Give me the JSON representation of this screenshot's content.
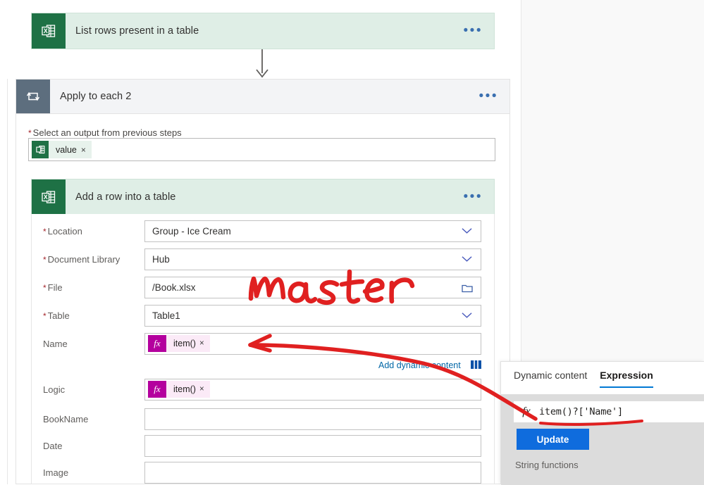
{
  "flow": {
    "steps": [
      {
        "title": "List rows present in a table",
        "icon": "excel-icon",
        "menu": "•••"
      },
      {
        "title": "Apply to each 2",
        "icon": "loop-icon",
        "menu": "•••"
      },
      {
        "title": "Add a row into a table",
        "icon": "excel-icon",
        "menu": "•••"
      }
    ],
    "loop": {
      "select_output_label": "Select an output from previous steps",
      "required_marker": "*",
      "token": {
        "label": "value",
        "remove": "×"
      }
    }
  },
  "add_row_fields": [
    {
      "label": "Location",
      "required": true,
      "type": "dropdown",
      "value": "Group - Ice Cream"
    },
    {
      "label": "Document Library",
      "required": true,
      "type": "dropdown",
      "value": "Hub"
    },
    {
      "label": "File",
      "required": true,
      "type": "file",
      "value": "/Book.xlsx"
    },
    {
      "label": "Table",
      "required": true,
      "type": "dropdown",
      "value": "Table1"
    },
    {
      "label": "Name",
      "required": false,
      "type": "token",
      "value": "item()"
    },
    {
      "label": "Logic",
      "required": false,
      "type": "token",
      "value": "item()"
    },
    {
      "label": "BookName",
      "required": false,
      "type": "text",
      "value": ""
    },
    {
      "label": "Date",
      "required": false,
      "type": "text",
      "value": ""
    },
    {
      "label": "Image",
      "required": false,
      "type": "text",
      "value": ""
    }
  ],
  "add_dynamic_content": {
    "label": "Add dynamic content",
    "icon": "dynamic-content-icon"
  },
  "expression_panel": {
    "tabs": [
      {
        "label": "Dynamic content",
        "active": false
      },
      {
        "label": "Expression",
        "active": true
      }
    ],
    "fx_symbol": "fx",
    "expression_value": "item()?['Name']",
    "update_label": "Update",
    "section_label": "String functions"
  },
  "annotations": {
    "handwriting": "master",
    "ink_color": "#e02020",
    "marks": [
      "arrow-to-name-field",
      "underline-expression",
      "handwritten-master"
    ]
  },
  "colors": {
    "excel_green": "#1e7145",
    "card_header_green": "#dfeee6",
    "loop_gray": "#5d6e7e",
    "token_magenta": "#b4009e",
    "link_blue": "#0066a6",
    "primary_blue": "#0f6cdd",
    "required_red": "#a4262c",
    "ink_red": "#e02020"
  }
}
